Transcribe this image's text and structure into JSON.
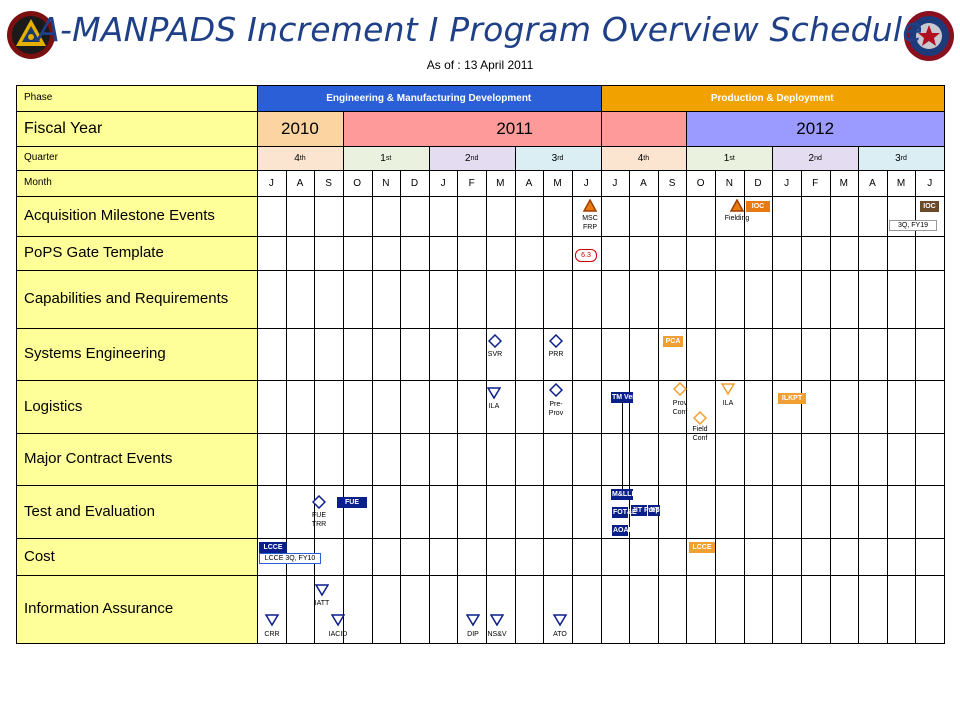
{
  "title": "A-MANPADS Increment I Program Overview Schedule",
  "as_of": "As of : 13 April 2011",
  "colors": {
    "title": "#1f3f86",
    "label_bg": "#ffff99",
    "emd": "#2a5fd8",
    "production": "#f2a200",
    "fy2010": "#fbd4a2",
    "fy2011": "#ff9a9a",
    "fy2012": "#9a9aff",
    "q4": "#fbe4d0",
    "q1": "#eaf1de",
    "q2": "#e4dcf0",
    "q3": "#dbeef4",
    "blue_event": "#0b1f8a",
    "orange_event": "#f0a030"
  },
  "row_labels": {
    "phase": "Phase",
    "fiscal_year": "Fiscal Year",
    "quarter": "Quarter",
    "month": "Month",
    "acquisition": "Acquisition Milestone Events",
    "pops": "PoPS Gate Template",
    "capabilities": "Capabilities and Requirements",
    "systems_eng": "Systems Engineering",
    "logistics": "Logistics",
    "contract": "Major Contract Events",
    "test_eval": "Test and Evaluation",
    "cost": "Cost",
    "info_assurance": "Information Assurance"
  },
  "phases": [
    "Engineering & Manufacturing Development",
    "Production & Deployment"
  ],
  "fiscal_years": [
    "2010",
    "2011",
    "2012"
  ],
  "quarters": [
    "4",
    "1",
    "2",
    "3",
    "4",
    "1",
    "2",
    "3"
  ],
  "quarter_suffixes": [
    "th",
    "st",
    "nd",
    "rd",
    "th",
    "st",
    "nd",
    "rd"
  ],
  "months": [
    "J",
    "A",
    "S",
    "O",
    "N",
    "D",
    "J",
    "F",
    "M",
    "A",
    "M",
    "J",
    "J",
    "A",
    "S",
    "O",
    "N",
    "D",
    "J",
    "F",
    "M",
    "A",
    "M",
    "J"
  ],
  "events": {
    "msc_frp": "MSC\nFRP",
    "fielding": "Fielding",
    "ioc_acq": "IOC",
    "ioc_acq2": "IOC",
    "ioc_3q": "3Q, FY19",
    "gate_63": "6.3",
    "svr": "SVR",
    "prr": "PRR",
    "pca": "PCA",
    "ila_log": "ILA",
    "pre_prov": "Pre-\nProv",
    "tm_ver": "TM Ver",
    "prov_conf": "Prov\nConf",
    "field_conf": "Field\nConf",
    "ila_log2": "ILA",
    "ilkpt": "ILKPT",
    "fue_trr": "FUE\nTRR",
    "fue": "FUE",
    "m_lld": "M&LLD",
    "jit_prep": "JIT\nPrep",
    "jit": "JIT",
    "ot_small": "FOT&E",
    "aoam": "AOAM",
    "lcce": "LCCE",
    "lcce_3q": "LCCE 3Q, FY10",
    "lcce2": "LCCE",
    "iatt": "IATT",
    "crr": "CRR",
    "iacid": "IACID",
    "dip": "DIP",
    "nsv": "NS&V",
    "ato": "ATO"
  }
}
